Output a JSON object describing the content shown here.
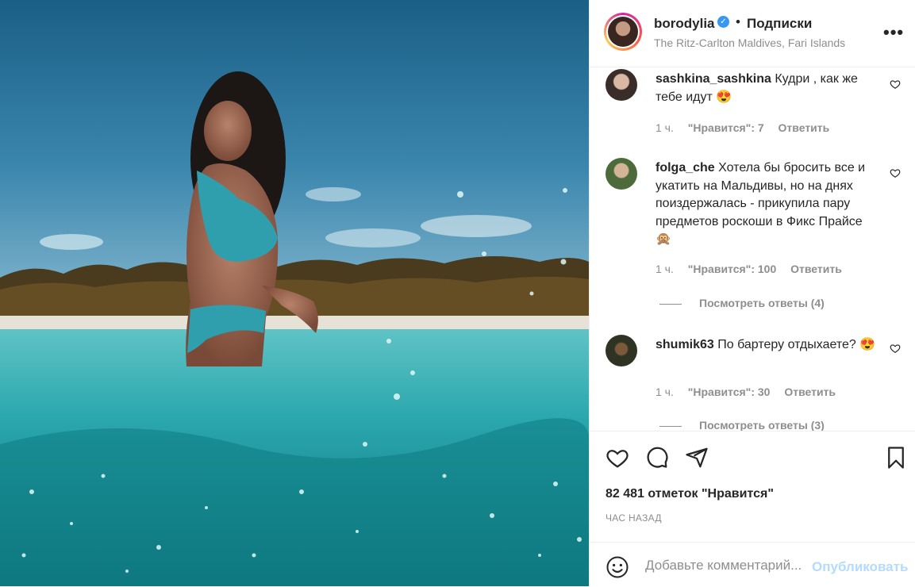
{
  "header": {
    "username": "borodylia",
    "separator": "•",
    "follow_label": "Подписки",
    "location": "The Ritz-Carlton Maldives, Fari Islands",
    "more_label": "•••",
    "verified_glyph": "✓"
  },
  "comments": [
    {
      "username": "sashkina_sashkina",
      "text": "Кудри , как же тебе идут 😍",
      "time": "1 ч.",
      "likes": "\"Нравится\": 7",
      "reply_label": "Ответить",
      "avatar_color": "#cfc6c0"
    },
    {
      "username": "folga_che",
      "text": "Хотела бы бросить все и укатить на Мальдивы, но на днях поиздержалась - прикупила пару предметов роскоши в Фикс Прайсе 🙊",
      "time": "1 ч.",
      "likes": "\"Нравится\": 100",
      "reply_label": "Ответить",
      "view_replies": "Посмотреть ответы (4)",
      "avatar_color": "#4d6b3a"
    },
    {
      "username": "shumik63",
      "text": "По бартеру отдыхаете? 😍",
      "time": "1 ч.",
      "likes": "\"Нравится\": 30",
      "reply_label": "Ответить",
      "view_replies": "Посмотреть ответы (3)",
      "avatar_color": "#2e3324"
    }
  ],
  "actions": {
    "like_icon": "heart-outline-icon",
    "comment_icon": "speech-bubble-icon",
    "share_icon": "paper-plane-icon",
    "save_icon": "bookmark-icon"
  },
  "likes_count": "82 481 отметок \"Нравится\"",
  "time_ago": "ЧАС НАЗАД",
  "add_comment": {
    "placeholder": "Добавьте комментарий...",
    "post_label": "Опубликовать",
    "emoji_icon": "smiley-icon"
  },
  "colors": {
    "link_disabled": "#b3dbff",
    "verified": "#3897f0",
    "muted": "#8e8e8e"
  }
}
